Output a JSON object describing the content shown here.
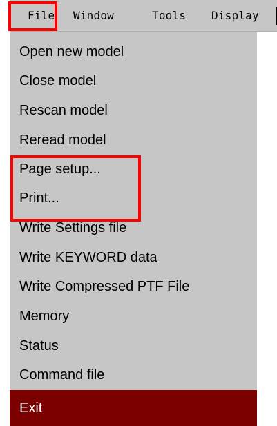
{
  "menubar": {
    "file": "File",
    "window": "Window",
    "tools": "Tools",
    "display": "Display"
  },
  "file_menu": {
    "items": [
      "Open new model",
      "Close model",
      "Rescan model",
      "Reread model",
      "Page setup...",
      "Print...",
      "Write Settings file",
      "Write KEYWORD data",
      "Write Compressed PTF File",
      "Memory",
      "Status",
      "Command file",
      "Exit"
    ],
    "selected": "Exit"
  },
  "colors": {
    "menu_background": "#c6c6c6",
    "selected_background": "#7d0000",
    "selected_text": "#ffffff",
    "highlight_border": "#ff0000"
  }
}
